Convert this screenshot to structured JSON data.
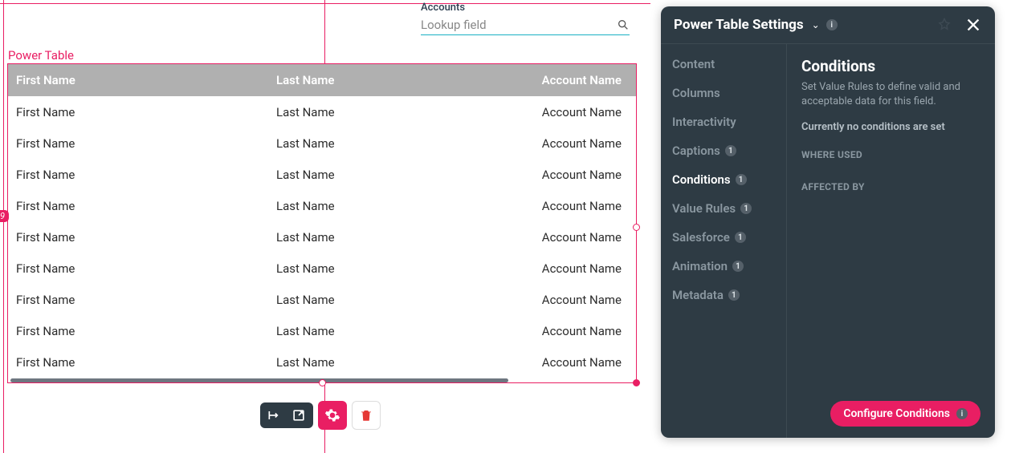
{
  "lookup": {
    "label": "Accounts",
    "placeholder": "Lookup field"
  },
  "powerTable": {
    "label": "Power Table",
    "guideBadge": "9",
    "headers": [
      "First Name",
      "Last Name",
      "Account Name"
    ],
    "rows": [
      {
        "first": "First Name",
        "last": "Last Name",
        "account": "Account Name"
      },
      {
        "first": "First Name",
        "last": "Last Name",
        "account": "Account Name"
      },
      {
        "first": "First Name",
        "last": "Last Name",
        "account": "Account Name"
      },
      {
        "first": "First Name",
        "last": "Last Name",
        "account": "Account Name"
      },
      {
        "first": "First Name",
        "last": "Last Name",
        "account": "Account Name"
      },
      {
        "first": "First Name",
        "last": "Last Name",
        "account": "Account Name"
      },
      {
        "first": "First Name",
        "last": "Last Name",
        "account": "Account Name"
      },
      {
        "first": "First Name",
        "last": "Last Name",
        "account": "Account Name"
      },
      {
        "first": "First Name",
        "last": "Last Name",
        "account": "Account Name"
      }
    ]
  },
  "panel": {
    "title": "Power Table Settings",
    "nav": [
      {
        "label": "Content",
        "badge": null,
        "active": false
      },
      {
        "label": "Columns",
        "badge": null,
        "active": false
      },
      {
        "label": "Interactivity",
        "badge": null,
        "active": false
      },
      {
        "label": "Captions",
        "badge": "1",
        "active": false
      },
      {
        "label": "Conditions",
        "badge": "1",
        "active": true
      },
      {
        "label": "Value Rules",
        "badge": "1",
        "active": false
      },
      {
        "label": "Salesforce",
        "badge": "1",
        "active": false
      },
      {
        "label": "Animation",
        "badge": "1",
        "active": false
      },
      {
        "label": "Metadata",
        "badge": "1",
        "active": false
      }
    ],
    "detail": {
      "title": "Conditions",
      "desc": "Set Value Rules to define valid and acceptable data for this field.",
      "status": "Currently no conditions are set",
      "sections": [
        "WHERE USED",
        "AFFECTED BY"
      ],
      "button": "Configure Conditions"
    }
  }
}
